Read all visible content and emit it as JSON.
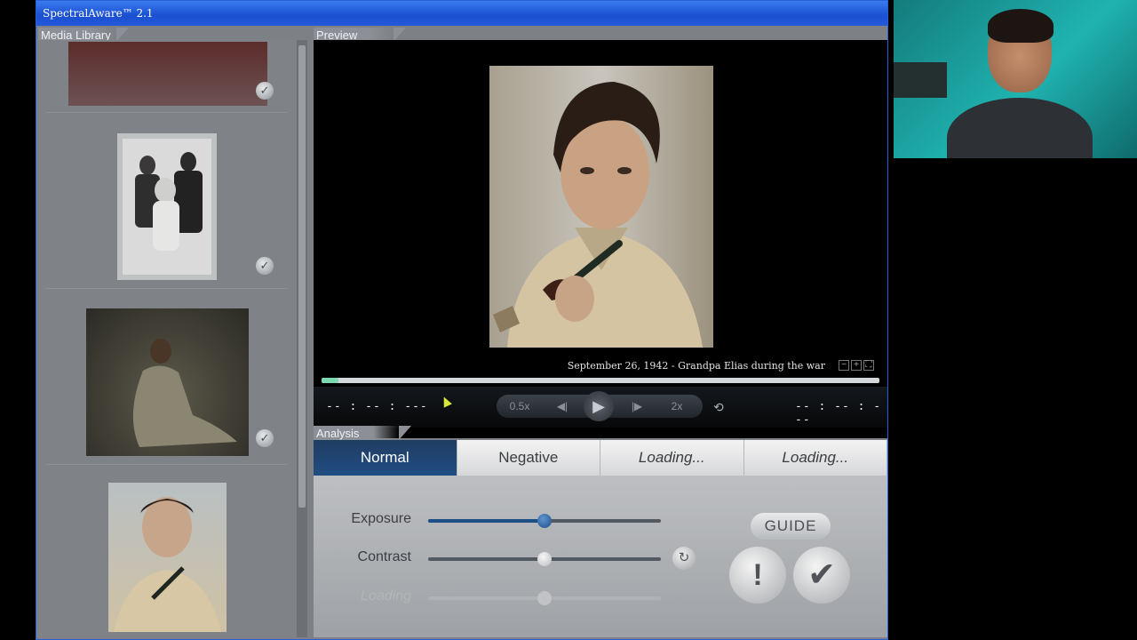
{
  "window": {
    "title": "SpectralAware™ 2.1"
  },
  "library": {
    "label": "Media Library",
    "items": [
      {
        "name": "photo-woman-red",
        "selected": true
      },
      {
        "name": "photo-family",
        "selected": true
      },
      {
        "name": "photo-woman-field",
        "selected": true
      },
      {
        "name": "photo-young-man-pipe",
        "selected": false
      }
    ]
  },
  "preview": {
    "label": "Preview",
    "caption": "September 26, 1942 - Grandpa Elias during the war",
    "progress": 0.03,
    "zoom_out": "−",
    "zoom_in": "+",
    "fullscreen": "⛶"
  },
  "transport": {
    "time_left": "-- : -- : ---",
    "time_right": "-- : -- : ---",
    "slow": "0.5x",
    "fast": "2x",
    "prev": "◀|",
    "play": "▶",
    "next": "|▶",
    "loop": "⟲"
  },
  "analysis": {
    "label": "Analysis",
    "tabs": [
      "Normal",
      "Negative",
      "Loading...",
      "Loading..."
    ],
    "active_tab": 0,
    "sliders": [
      {
        "label": "Exposure",
        "value": 0.5
      },
      {
        "label": "Contrast",
        "value": 0.5
      },
      {
        "label": "Loading",
        "value": 0.5
      }
    ],
    "guide": "GUIDE",
    "warn": "!",
    "ok": "✔",
    "reset": "↻"
  },
  "colors": {
    "accent": "#1e4e86",
    "titlebar": "#1a4fd0",
    "progress": "#7bd8b0"
  }
}
